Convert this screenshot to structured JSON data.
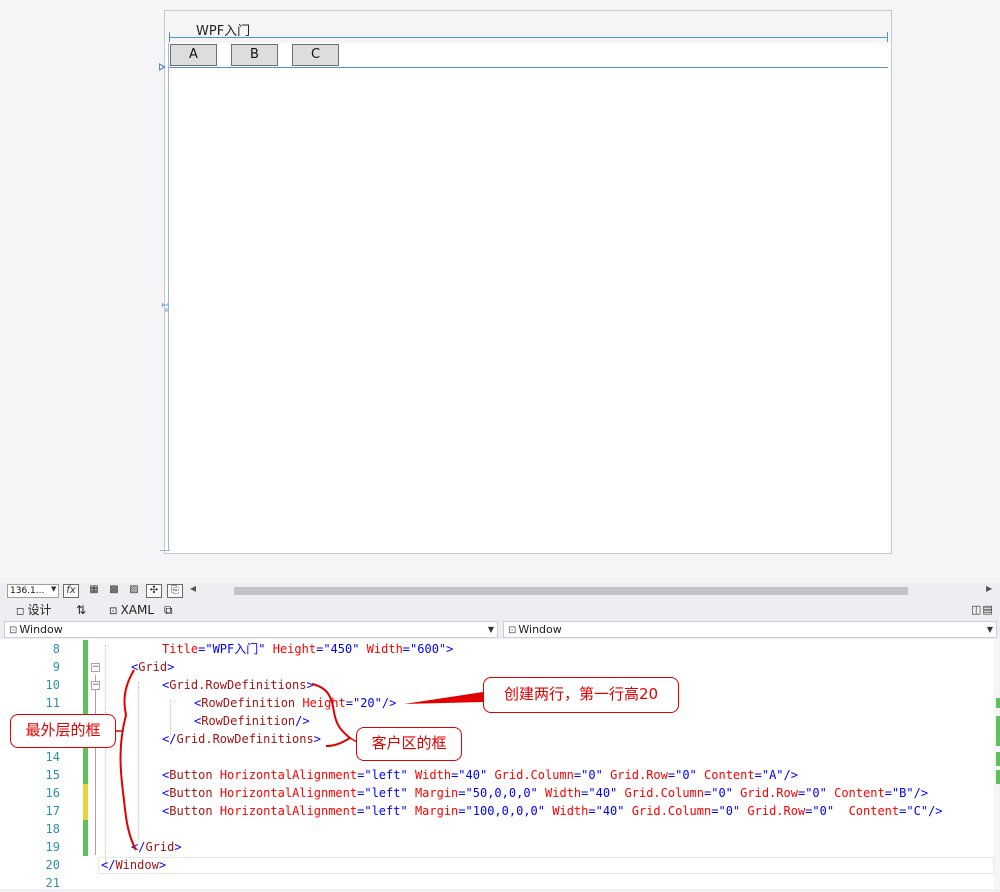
{
  "designer": {
    "window_title": "WPF入门",
    "row_size_label": "1*",
    "buttons": [
      {
        "content": "A"
      },
      {
        "content": "B"
      },
      {
        "content": "C"
      }
    ]
  },
  "toolbar": {
    "zoom": "136.1...",
    "fx_label": "fx"
  },
  "tabs": {
    "design": "设计",
    "swap": "⇅",
    "xaml": "XAML"
  },
  "nav": {
    "left": "Window",
    "right": "Window"
  },
  "editor": {
    "line_numbers": [
      "8",
      "9",
      "10",
      "11",
      "12",
      "13",
      "14",
      "15",
      "16",
      "17",
      "18",
      "19",
      "20",
      "21"
    ]
  },
  "annotations": {
    "outer_frame": "最外层的框",
    "client_area": "客户区的框",
    "two_rows": "创建两行，第一行高20"
  },
  "colors": {
    "tag": "#a31515",
    "attribute": "#ff0000",
    "value": "#0000ff",
    "line_number": "#2b91af",
    "annotation": "#e00000",
    "designer_guide": "#5b8fd6"
  }
}
